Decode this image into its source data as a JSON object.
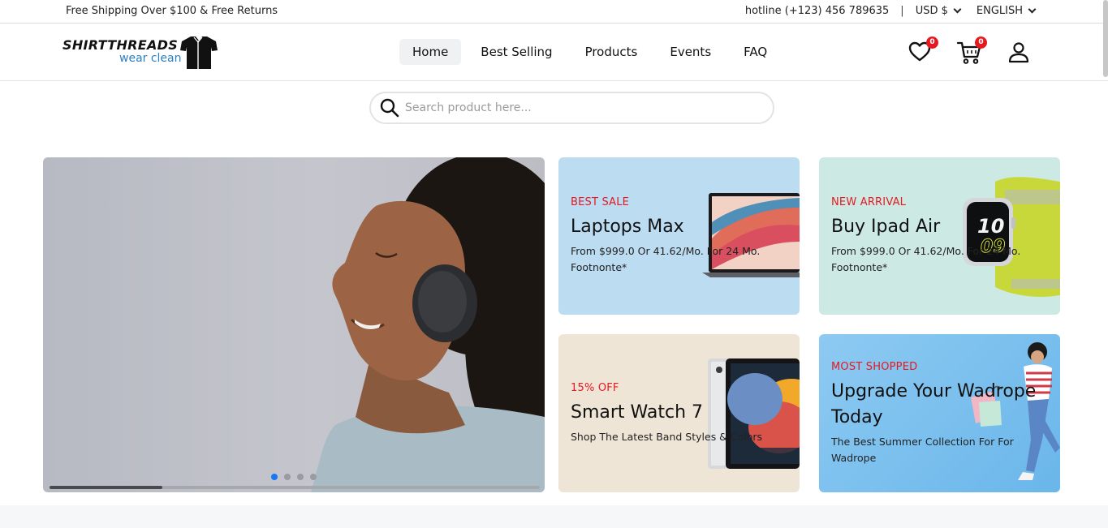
{
  "topbar": {
    "promo": "Free Shipping Over $100 & Free Returns",
    "hotline": "hotline (+123) 456 789635",
    "separator": "|",
    "currency": "USD $",
    "language": "ENGLISH"
  },
  "logo": {
    "brand": "SHIRTTHREADS",
    "tagline": "wear clean"
  },
  "nav": {
    "items": [
      {
        "label": "Home",
        "active": true
      },
      {
        "label": "Best Selling",
        "active": false
      },
      {
        "label": "Products",
        "active": false
      },
      {
        "label": "Events",
        "active": false
      },
      {
        "label": "FAQ",
        "active": false
      }
    ]
  },
  "header_icons": {
    "wishlist_icon": "heart-icon",
    "wishlist_count": "0",
    "cart_icon": "cart-icon",
    "cart_count": "0",
    "account_icon": "user-icon"
  },
  "search": {
    "placeholder": "Search product here...",
    "value": "",
    "icon": "search-icon"
  },
  "hero": {
    "slide_count": 4,
    "active_slide": 1,
    "progress_fraction": 0.23
  },
  "cards": [
    {
      "eyebrow": "BEST SALE",
      "title": "Laptops Max",
      "desc": "From $999.0 Or 41.62/Mo. For 24 Mo. Footnonte*"
    },
    {
      "eyebrow": "NEW ARRIVAL",
      "title": "Buy Ipad Air",
      "desc": "From $999.0 Or 41.62/Mo. For 24 Mo. Footnonte*",
      "watch_digits_top": "10",
      "watch_digits_bottom": "09"
    },
    {
      "eyebrow": "15% OFF",
      "title": "Smart Watch 7",
      "desc": "Shop The Latest Band Styles & Colors"
    },
    {
      "eyebrow": "MOST SHOPPED",
      "title": "Upgrade Your Wadrope Today",
      "desc": "The Best Summer Collection For For Wadrope"
    }
  ],
  "colors": {
    "accent_red": "#e5191f",
    "active_dot": "#1877f2",
    "tagline_blue": "#2c7fc2"
  }
}
